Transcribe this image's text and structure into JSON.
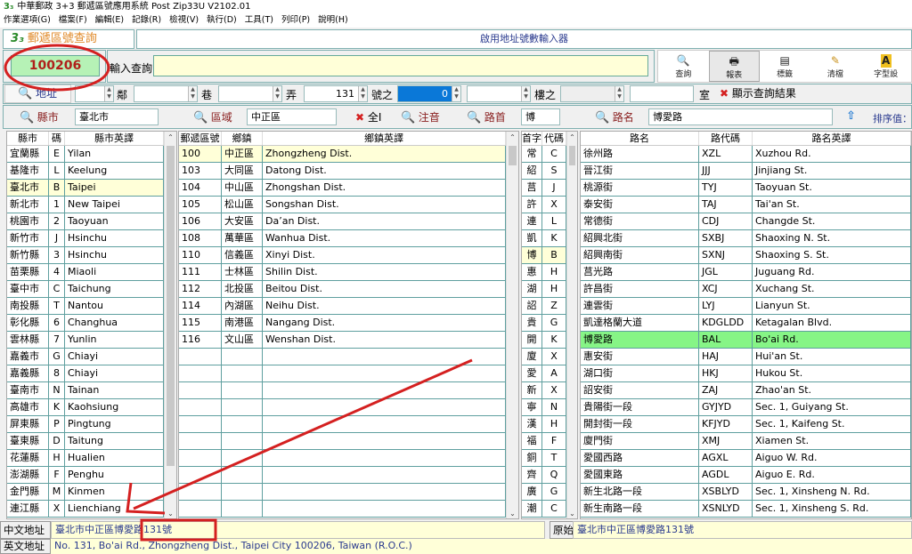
{
  "window": {
    "title": "中華郵政 3+3 郵遞區號應用系統 Post Zip33U V2102.01"
  },
  "menu": [
    "作業選項(G)",
    "檔案(F)",
    "編輯(E)",
    "記錄(R)",
    "檢視(V)",
    "執行(D)",
    "工具(T)",
    "列印(P)",
    "說明(H)"
  ],
  "logo_tab": "郵遞區號查詢",
  "banner": "啟用地址號數輸入器",
  "zip_result": "100206",
  "query": {
    "label": "輸入查詢",
    "value": ""
  },
  "toolbar": [
    {
      "label": "查詢",
      "icon": "search-icon"
    },
    {
      "label": "報表",
      "icon": "printer-icon"
    },
    {
      "label": "標籤",
      "icon": "label-icon"
    },
    {
      "label": "清檔",
      "icon": "broom-icon"
    },
    {
      "label": "字型設",
      "icon": "font-icon"
    }
  ],
  "address_row": {
    "button": "地址",
    "lin_label": "鄰",
    "lin": "",
    "xiang_label": "巷",
    "xiang": "",
    "nong_label": "弄",
    "nong": "",
    "hao": "131",
    "hao_zhi_label": "號之",
    "hao_zhi": "0",
    "lou": "",
    "lou_zhi_label": "樓之",
    "lou_zhi": "",
    "shi": "",
    "shi_label": "室",
    "show_results": "顯示查詢結果"
  },
  "filter_row": {
    "county_label": "縣市",
    "county": "臺北市",
    "district_label": "區域",
    "district": "中正區",
    "all_label": "全I",
    "zhuyin_label": "注音",
    "road_first_label": "路首",
    "road_first": "博",
    "road_name_label": "路名",
    "road_name": "博愛路",
    "sort_label": "排序值："
  },
  "county_table": {
    "headers": [
      "縣市",
      "碼",
      "縣市英譯"
    ],
    "selected": 2,
    "rows": [
      [
        "宜蘭縣",
        "E",
        "Yilan"
      ],
      [
        "基隆市",
        "L",
        "Keelung"
      ],
      [
        "臺北市",
        "B",
        "Taipei"
      ],
      [
        "新北市",
        "1",
        "New Taipei"
      ],
      [
        "桃園市",
        "2",
        "Taoyuan"
      ],
      [
        "新竹市",
        "J",
        "Hsinchu"
      ],
      [
        "新竹縣",
        "3",
        "Hsinchu"
      ],
      [
        "苗栗縣",
        "4",
        "Miaoli"
      ],
      [
        "臺中市",
        "C",
        "Taichung"
      ],
      [
        "南投縣",
        "T",
        "Nantou"
      ],
      [
        "彰化縣",
        "6",
        "Changhua"
      ],
      [
        "雲林縣",
        "7",
        "Yunlin"
      ],
      [
        "嘉義市",
        "G",
        "Chiayi"
      ],
      [
        "嘉義縣",
        "8",
        "Chiayi"
      ],
      [
        "臺南市",
        "N",
        "Tainan"
      ],
      [
        "高雄市",
        "K",
        "Kaohsiung"
      ],
      [
        "屏東縣",
        "P",
        "Pingtung"
      ],
      [
        "臺東縣",
        "D",
        "Taitung"
      ],
      [
        "花蓮縣",
        "H",
        "Hualien"
      ],
      [
        "澎湖縣",
        "F",
        "Penghu"
      ],
      [
        "金門縣",
        "M",
        "Kinmen"
      ],
      [
        "連江縣",
        "X",
        "Lienchiang"
      ]
    ]
  },
  "district_table": {
    "headers": [
      "郵遞區號",
      "鄉鎮",
      "鄉鎮英譯"
    ],
    "selected": 0,
    "rows": [
      [
        "100",
        "中正區",
        "Zhongzheng Dist."
      ],
      [
        "103",
        "大同區",
        "Datong Dist."
      ],
      [
        "104",
        "中山區",
        "Zhongshan Dist."
      ],
      [
        "105",
        "松山區",
        "Songshan Dist."
      ],
      [
        "106",
        "大安區",
        "Da’an Dist."
      ],
      [
        "108",
        "萬華區",
        "Wanhua Dist."
      ],
      [
        "110",
        "信義區",
        "Xinyi Dist."
      ],
      [
        "111",
        "士林區",
        "Shilin Dist."
      ],
      [
        "112",
        "北投區",
        "Beitou Dist."
      ],
      [
        "114",
        "內湖區",
        "Neihu Dist."
      ],
      [
        "115",
        "南港區",
        "Nangang Dist."
      ],
      [
        "116",
        "文山區",
        "Wenshan Dist."
      ]
    ]
  },
  "initial_table": {
    "headers": [
      "首字",
      "代碼"
    ],
    "selected": 6,
    "rows": [
      [
        "常",
        "C"
      ],
      [
        "紹",
        "S"
      ],
      [
        "莒",
        "J"
      ],
      [
        "許",
        "X"
      ],
      [
        "連",
        "L"
      ],
      [
        "凱",
        "K"
      ],
      [
        "博",
        "B"
      ],
      [
        "惠",
        "H"
      ],
      [
        "湖",
        "H"
      ],
      [
        "詔",
        "Z"
      ],
      [
        "貴",
        "G"
      ],
      [
        "開",
        "K"
      ],
      [
        "廈",
        "X"
      ],
      [
        "愛",
        "A"
      ],
      [
        "新",
        "X"
      ],
      [
        "寧",
        "N"
      ],
      [
        "漢",
        "H"
      ],
      [
        "福",
        "F"
      ],
      [
        "銅",
        "T"
      ],
      [
        "齊",
        "Q"
      ],
      [
        "廣",
        "G"
      ],
      [
        "潮",
        "C"
      ]
    ]
  },
  "road_table": {
    "headers": [
      "路名",
      "路代碼",
      "路名英譯"
    ],
    "highlighted": 11,
    "rows": [
      [
        "徐州路",
        "XZL",
        "Xuzhou Rd."
      ],
      [
        "晉江街",
        "JJJ",
        "Jinjiang St."
      ],
      [
        "桃源街",
        "TYJ",
        "Taoyuan St."
      ],
      [
        "泰安街",
        "TAJ",
        "Tai'an St."
      ],
      [
        "常德街",
        "CDJ",
        "Changde St."
      ],
      [
        "紹興北街",
        "SXBJ",
        "Shaoxing N. St."
      ],
      [
        "紹興南街",
        "SXNJ",
        "Shaoxing S. St."
      ],
      [
        "莒光路",
        "JGL",
        "Juguang Rd."
      ],
      [
        "許昌街",
        "XCJ",
        "Xuchang St."
      ],
      [
        "連雲街",
        "LYJ",
        "Lianyun St."
      ],
      [
        "凱達格蘭大道",
        "KDGLDD",
        "Ketagalan Blvd."
      ],
      [
        "博愛路",
        "BAL",
        "Bo'ai Rd."
      ],
      [
        "惠安街",
        "HAJ",
        "Hui'an St."
      ],
      [
        "湖口街",
        "HKJ",
        "Hukou St."
      ],
      [
        "詔安街",
        "ZAJ",
        "Zhao'an St."
      ],
      [
        "貴陽街一段",
        "GYJYD",
        "Sec. 1, Guiyang St."
      ],
      [
        "開封街一段",
        "KFJYD",
        "Sec. 1, Kaifeng St."
      ],
      [
        "廈門街",
        "XMJ",
        "Xiamen St."
      ],
      [
        "愛國西路",
        "AGXL",
        "Aiguo W. Rd."
      ],
      [
        "愛國東路",
        "AGDL",
        "Aiguo E. Rd."
      ],
      [
        "新生北路一段",
        "XSBLYD",
        "Sec. 1, Xinsheng N. Rd."
      ],
      [
        "新生南路一段",
        "XSNLYD",
        "Sec. 1, Xinsheng S. Rd."
      ]
    ]
  },
  "address": {
    "cn_label": "中文地址",
    "cn_value": "臺北市中正區博愛路131號",
    "orig_label": "原始地址",
    "orig_value": "臺北市中正區博愛路131號",
    "en_label": "英文地址",
    "en_value": "No. 131, Bo'ai Rd., Zhongzheng Dist., Taipei City 100206, Taiwan (R.O.C.)"
  },
  "colors": {
    "annotation": "#d42020",
    "highlight": "#86f586",
    "selected": "#ffffd8",
    "zip_bg": "#b6f2b6"
  }
}
